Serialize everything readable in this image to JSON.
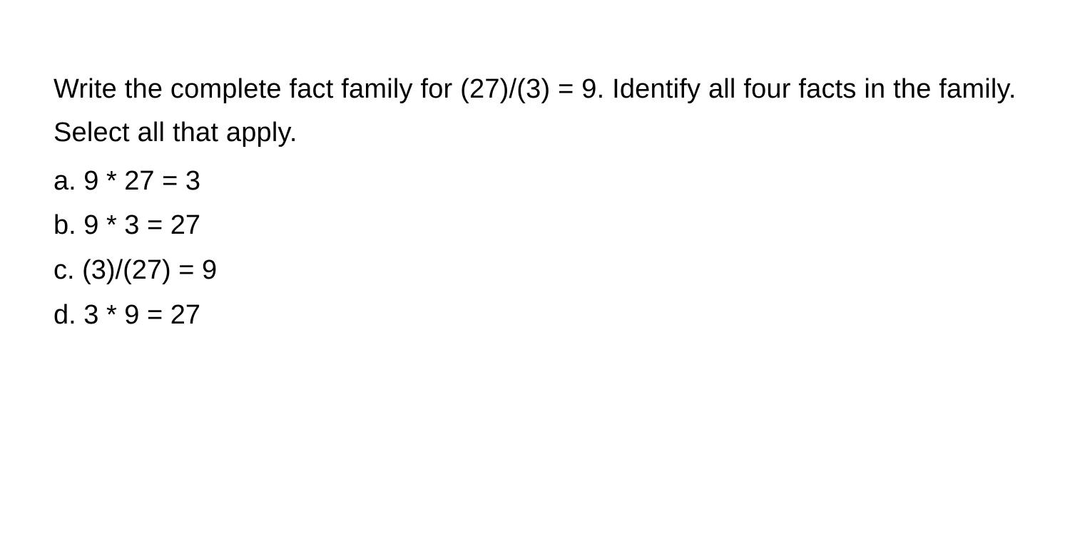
{
  "question": {
    "prompt": "Write the complete fact family for (27)/(3) = 9. Identify all four facts in the family. Select all that apply."
  },
  "options": {
    "a": "a. 9 * 27 = 3",
    "b": "b. 9 * 3 = 27",
    "c": "c. (3)/(27) = 9",
    "d": "d. 3 * 9 = 27"
  }
}
